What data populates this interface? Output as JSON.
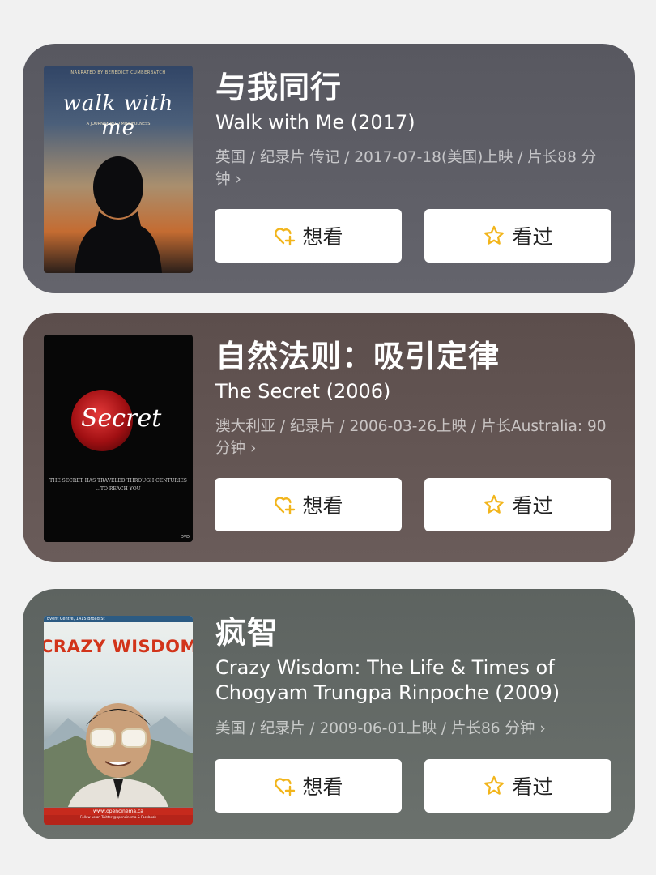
{
  "movies": [
    {
      "cn_title": "与我同行",
      "en_title": "Walk with Me (2017)",
      "meta": "英国 / 纪录片 传记 / 2017-07-18(美国)上映 / 片长88 分钟",
      "chevron": "›",
      "want_label": "想看",
      "seen_label": "看过",
      "poster": {
        "top_text": "NARRATED BY BENEDICT CUMBERBATCH",
        "title": "walk with me",
        "sub": "A JOURNEY INTO MINDFULNESS"
      }
    },
    {
      "cn_title": "自然法则：吸引定律",
      "en_title": "The Secret (2006)",
      "meta": "澳大利亚 / 纪录片 / 2006-03-26上映 / 片长Australia: 90 分钟",
      "chevron": "›",
      "want_label": "想看",
      "seen_label": "看过",
      "poster": {
        "title": "Secret",
        "tagline": "THE SECRET HAS TRAVELED THROUGH CENTURIES ...TO REACH YOU",
        "badge": "DVD"
      }
    },
    {
      "cn_title": "疯智",
      "en_title": "Crazy Wisdom: The Life & Times of Chogyam Trungpa Rinpoche (2009)",
      "meta": "美国 / 纪录片 / 2009-06-01上映 / 片长86 分钟",
      "chevron": "›",
      "want_label": "想看",
      "seen_label": "看过",
      "poster": {
        "strip": "Event Centre, 1415 Broad St",
        "title": "CRAZY WISDOM",
        "url": "www.opencinema.ca",
        "foot": "Follow us on Twitter @opencinema & Facebook"
      }
    }
  ],
  "colors": {
    "want_icon": "#f2b51c",
    "seen_icon": "#f2b51c"
  },
  "icons": {
    "want": "heart-plus-icon",
    "seen": "star-icon"
  }
}
